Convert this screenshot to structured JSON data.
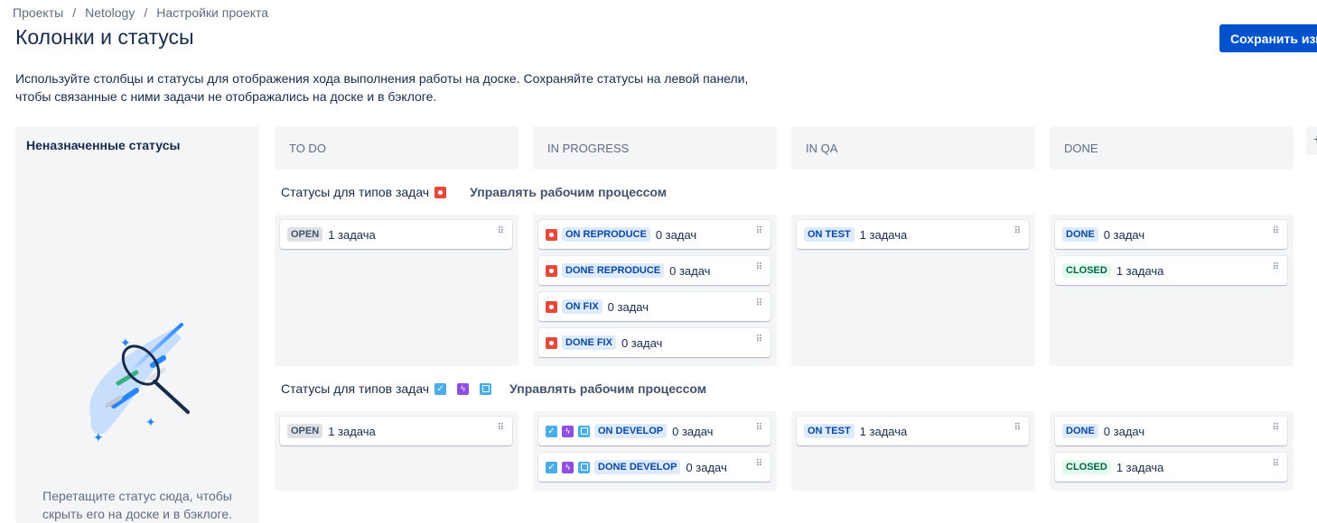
{
  "breadcrumb": {
    "projects": "Проекты",
    "project": "Netology",
    "settings": "Настройки проекта",
    "separator": "/"
  },
  "title": "Колонки и статусы",
  "save_button": "Сохранить изм",
  "description": "Используйте столбцы и статусы для отображения хода выполнения работы на доске. Сохраняйте статусы на левой панели, чтобы связанные с ними задачи не отображались на доске и в бэклоге.",
  "unassigned": {
    "title": "Неназначенные статусы",
    "hint": "Перетащите статус сюда, чтобы скрыть его на доске и в бэклоге."
  },
  "columns": [
    "TO DO",
    "IN PROGRESS",
    "IN QA",
    "DONE"
  ],
  "more_columns_glyph": "+",
  "groups": [
    {
      "label": "Статусы для типов задач",
      "icons": [
        "bug-icon"
      ],
      "link": "Управлять рабочим процессом"
    },
    {
      "label": "Статусы для типов задач",
      "icons": [
        "task-icon",
        "subtask-icon",
        "story-icon"
      ],
      "link": "Управлять рабочим процессом"
    }
  ],
  "cards": {
    "g1_todo": {
      "status": "OPEN",
      "count": "1 задача"
    },
    "g1_inprog": [
      {
        "status": "ON REPRODUCE",
        "count": "0 задач"
      },
      {
        "status": "DONE REPRODUCE",
        "count": "0 задач"
      },
      {
        "status": "ON FIX",
        "count": "0 задач"
      },
      {
        "status": "DONE FIX",
        "count": "0 задач"
      }
    ],
    "g1_qa": {
      "status": "ON TEST",
      "count": "1 задача"
    },
    "g1_done": [
      {
        "status": "DONE",
        "count": "0 задач"
      },
      {
        "status": "CLOSED",
        "count": "1 задача"
      }
    ],
    "g2_todo": {
      "status": "OPEN",
      "count": "1 задача"
    },
    "g2_inprog": [
      {
        "status": "ON DEVELOP",
        "count": "0 задач"
      },
      {
        "status": "DONE DEVELOP",
        "count": "0 задач"
      }
    ],
    "g2_qa": {
      "status": "ON TEST",
      "count": "1 задача"
    },
    "g2_done": [
      {
        "status": "DONE",
        "count": "0 задач"
      },
      {
        "status": "CLOSED",
        "count": "1 задача"
      }
    ]
  },
  "icon_glyphs": {
    "drag": "⠿",
    "task_check": "✓",
    "subtask_bolt": "ϟ"
  },
  "colors": {
    "primary": "#0052cc",
    "bug": "#e5493a",
    "task": "#4bade8",
    "subtask": "#904ee2"
  }
}
